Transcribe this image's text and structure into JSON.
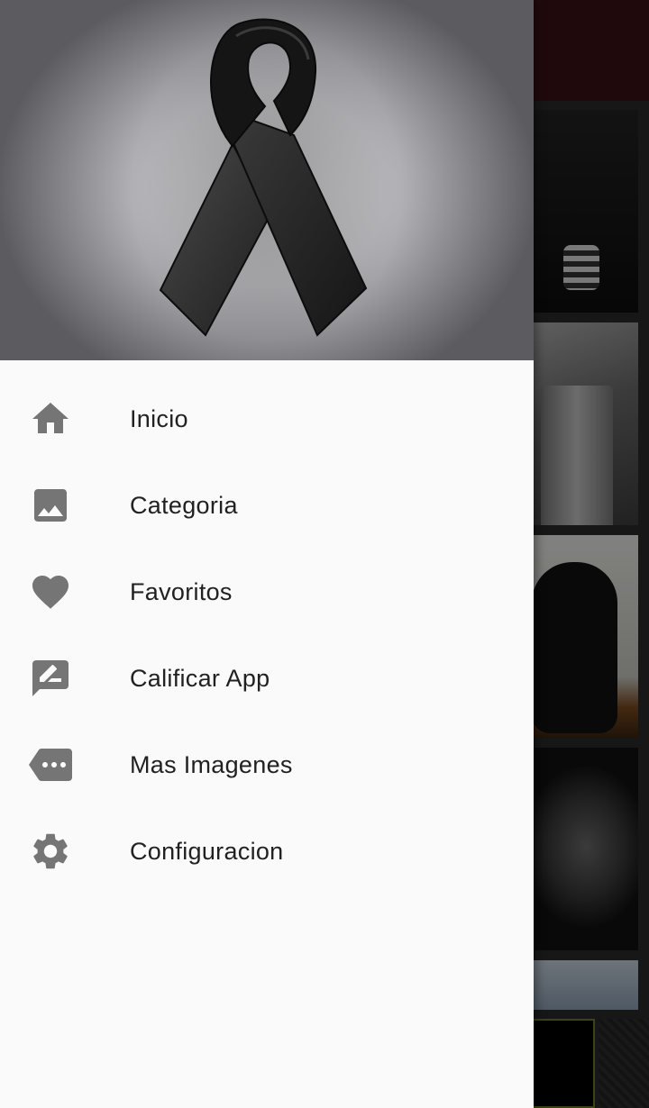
{
  "drawer": {
    "items": [
      {
        "label": "Inicio",
        "icon": "home-icon"
      },
      {
        "label": "Categoria",
        "icon": "image-icon"
      },
      {
        "label": "Favoritos",
        "icon": "heart-icon"
      },
      {
        "label": "Calificar App",
        "icon": "rate-review-icon"
      },
      {
        "label": "Mas Imagenes",
        "icon": "more-icon"
      },
      {
        "label": "Configuracion",
        "icon": "settings-icon"
      }
    ]
  },
  "colors": {
    "toolbar": "#3b1216",
    "drawer_background": "#fafafa",
    "icon": "#757575",
    "label": "#212121"
  }
}
